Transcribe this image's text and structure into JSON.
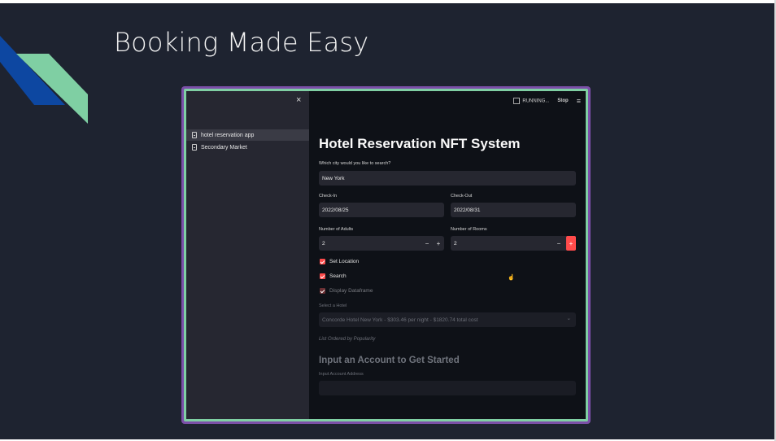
{
  "slide": {
    "title": "Booking Made Easy",
    "colors": {
      "background": "#1e2330",
      "accent_blue": "#0d47a1",
      "accent_green": "#7fcfa3",
      "frame_purple": "#7b4fa8"
    }
  },
  "app": {
    "sidebar": {
      "close_icon": "×",
      "items": [
        {
          "label": "hotel reservation app",
          "icon": "document-icon",
          "active": true
        },
        {
          "label": "Secondary Market",
          "icon": "document-icon",
          "active": false
        }
      ]
    },
    "topbar": {
      "status": "RUNNING...",
      "stop_label": "Stop",
      "menu_icon": "≡"
    },
    "main": {
      "title": "Hotel Reservation NFT System",
      "city": {
        "label": "Which city would you like to search?",
        "value": "New York"
      },
      "checkin": {
        "label": "Check-In",
        "value": "2022/08/25"
      },
      "checkout": {
        "label": "Check-Out",
        "value": "2022/08/31"
      },
      "adults": {
        "label": "Number of Adults",
        "value": "2",
        "minus": "−",
        "plus": "+"
      },
      "rooms": {
        "label": "Number of Rooms",
        "value": "2",
        "minus": "−",
        "plus": "+"
      },
      "checkboxes": [
        {
          "label": "Set Location",
          "checked": true
        },
        {
          "label": "Search",
          "checked": true
        },
        {
          "label": "Display Dataframe",
          "checked": true
        }
      ],
      "select_hotel": {
        "label": "Select a Hotel",
        "value": "Concorde Hotel New York - $303.46 per night - $1820.74 total cost",
        "chevron": "⌄"
      },
      "note": "List Ordered by Popularity",
      "section_title": "Input an Account to Get Started",
      "account": {
        "label": "Input Account Address",
        "value": ""
      }
    }
  }
}
